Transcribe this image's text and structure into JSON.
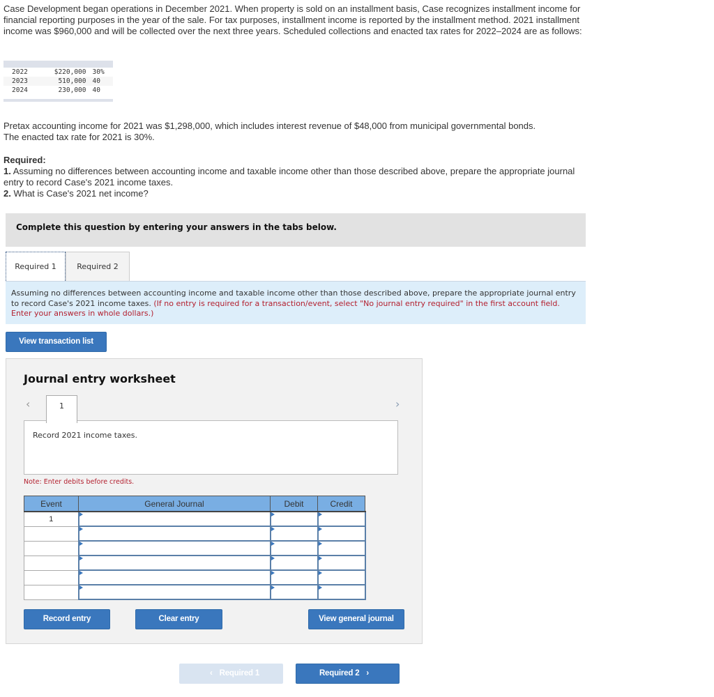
{
  "problem": {
    "intro": "Case Development began operations in December 2021. When property is sold on an installment basis, Case recognizes installment income for financial reporting purposes in the year of the sale. For tax purposes, installment income is reported by the installment method. 2021 installment income was $960,000 and will be collected over the next three years. Scheduled collections and enacted tax rates for 2022–2024 are as follows:",
    "schedule": [
      {
        "year": "2022",
        "amount": "$220,000",
        "rate": "30%"
      },
      {
        "year": "2023",
        "amount": "510,000",
        "rate": "40"
      },
      {
        "year": "2024",
        "amount": "230,000",
        "rate": "40"
      }
    ],
    "pretax_line1": "Pretax accounting income for 2021 was $1,298,000, which includes interest revenue of $48,000 from municipal governmental bonds.",
    "pretax_line2": "The enacted tax rate for 2021 is 30%.",
    "required_title": "Required:",
    "req1_num": "1.",
    "req1_text": " Assuming no differences between accounting income and taxable income other than those described above, prepare the appropriate journal entry to record Case's 2021 income taxes.",
    "req2_num": "2.",
    "req2_text": " What is Case's 2021 net income?"
  },
  "instruction_bar": "Complete this question by entering your answers in the tabs below.",
  "tabs": [
    {
      "label": "Required 1",
      "active": true
    },
    {
      "label": "Required 2",
      "active": false
    }
  ],
  "tab_panel": {
    "text": "Assuming no differences between accounting income and taxable income other than those described above, prepare the appropriate journal entry to record Case's 2021 income taxes. ",
    "note": "(If no entry is required for a transaction/event, select \"No journal entry required\" in the first account field. Enter your answers in whole dollars.)"
  },
  "buttons": {
    "view_transaction_list": "View transaction list",
    "record_entry": "Record entry",
    "clear_entry": "Clear entry",
    "view_general_journal": "View general journal",
    "prev_required": "Required 1",
    "next_required": "Required 2"
  },
  "worksheet": {
    "title": "Journal entry worksheet",
    "prev_icon": "‹",
    "next_icon": "›",
    "current_page": "1",
    "description": "Record 2021 income taxes.",
    "note": "Note: Enter debits before credits.",
    "columns": [
      "Event",
      "General Journal",
      "Debit",
      "Credit"
    ],
    "rows": [
      {
        "event": "1",
        "account": "",
        "debit": "",
        "credit": ""
      },
      {
        "event": "",
        "account": "",
        "debit": "",
        "credit": ""
      },
      {
        "event": "",
        "account": "",
        "debit": "",
        "credit": ""
      },
      {
        "event": "",
        "account": "",
        "debit": "",
        "credit": ""
      },
      {
        "event": "",
        "account": "",
        "debit": "",
        "credit": ""
      },
      {
        "event": "",
        "account": "",
        "debit": "",
        "credit": ""
      }
    ]
  },
  "icons": {
    "chevron_left": "‹",
    "chevron_right": "›"
  }
}
